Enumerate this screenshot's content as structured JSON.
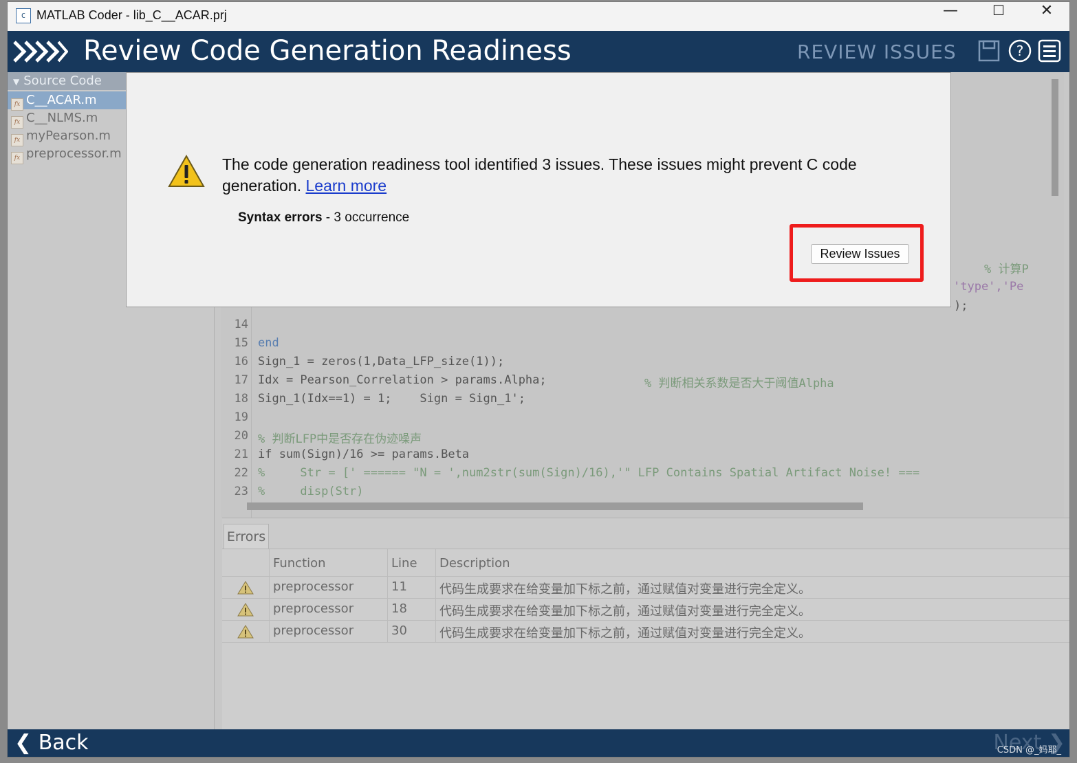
{
  "window": {
    "title": "MATLAB Coder - lib_C__ACAR.prj",
    "app_icon": "matlab-coder-icon",
    "controls": {
      "minimize": "—",
      "maximize": "☐",
      "close": "✕"
    }
  },
  "header": {
    "title": "Review Code Generation Readiness",
    "step": "REVIEW ISSUES",
    "icons": [
      "save-icon",
      "help-icon",
      "menu-icon"
    ]
  },
  "sidebar": {
    "section_label": "Source Code",
    "files": [
      {
        "name": "C__ACAR.m",
        "selected": true
      },
      {
        "name": "C__NLMS.m",
        "selected": false
      },
      {
        "name": "myPearson.m",
        "selected": false
      },
      {
        "name": "preprocessor.m",
        "selected": false
      }
    ]
  },
  "code": {
    "lines": [
      {
        "n": "14",
        "text": ""
      },
      {
        "n": "15",
        "text": "end"
      },
      {
        "n": "16",
        "text": "Sign_1 = zeros(1,Data_LFP_size(1));"
      },
      {
        "n": "17",
        "text": "Idx = Pearson_Correlation > params.Alpha;",
        "comment": "% 判断相关系数是否大于阈值Alpha"
      },
      {
        "n": "18",
        "text": "Sign_1(Idx==1) = 1;    Sign = Sign_1';"
      },
      {
        "n": "19",
        "text": ""
      },
      {
        "n": "20",
        "comment": "% 判断LFP中是否存在伪迹噪声"
      },
      {
        "n": "21",
        "text": "if sum(Sign)/16 >= params.Beta"
      },
      {
        "n": "22",
        "comment": "%     Str = [' ====== \"N = ',num2str(sum(Sign)/16),'\" LFP Contains Spatial Artifact Noise! ==="
      },
      {
        "n": "23",
        "comment": "%     disp(Str)"
      }
    ],
    "partial_right_1": "% 计算P",
    "partial_right_2": "'type','Pe",
    "partial_right_3": ");"
  },
  "errors": {
    "tab_label": "Errors",
    "columns": [
      "Function",
      "Line",
      "Description"
    ],
    "rows": [
      {
        "function": "preprocessor",
        "line": "11",
        "description": "代码生成要求在给变量加下标之前，通过赋值对变量进行完全定义。"
      },
      {
        "function": "preprocessor",
        "line": "18",
        "description": "代码生成要求在给变量加下标之前，通过赋值对变量进行完全定义。"
      },
      {
        "function": "preprocessor",
        "line": "30",
        "description": "代码生成要求在给变量加下标之前，通过赋值对变量进行完全定义。"
      }
    ]
  },
  "dialog": {
    "message": "The code generation readiness tool identified 3 issues. These issues might prevent C code generation.",
    "link": "Learn more",
    "issue_type": "Syntax errors",
    "issue_count": " - 3 occurrence",
    "button": "Review Issues",
    "highlight_color": "#ee1c1c"
  },
  "footer": {
    "back_label": "Back",
    "next_label": "Next"
  },
  "watermark": "CSDN @_妈耶_",
  "colors": {
    "header_bg": "#17385c",
    "link": "#1a3ccc",
    "warning": "#f2c21b"
  }
}
